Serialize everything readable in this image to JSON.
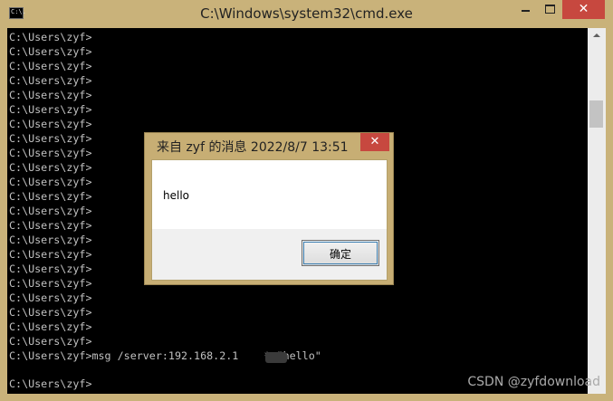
{
  "window": {
    "title": "C:\\Windows\\system32\\cmd.exe",
    "icon_label": "C:\\.",
    "close_glyph": "✕"
  },
  "console": {
    "prompt_lines": [
      "C:\\Users\\zyf>",
      "C:\\Users\\zyf>",
      "C:\\Users\\zyf>",
      "C:\\Users\\zyf>",
      "C:\\Users\\zyf>",
      "C:\\Users\\zyf>",
      "C:\\Users\\zyf>",
      "C:\\Users\\zyf>",
      "C:\\Users\\zyf>",
      "C:\\Users\\zyf>",
      "C:\\Users\\zyf>",
      "C:\\Users\\zyf>",
      "C:\\Users\\zyf>",
      "C:\\Users\\zyf>",
      "C:\\Users\\zyf>",
      "C:\\Users\\zyf>",
      "C:\\Users\\zyf>",
      "C:\\Users\\zyf>",
      "C:\\Users\\zyf>",
      "C:\\Users\\zyf>",
      "C:\\Users\\zyf>",
      "C:\\Users\\zyf>"
    ],
    "command_line": "C:\\Users\\zyf>msg /server:192.168.2.1    * \"hello\"",
    "blank_line": "",
    "last_prompt": "C:\\Users\\zyf>"
  },
  "dialog": {
    "title": "来自 zyf 的消息 2022/8/7 13:51",
    "close_glyph": "✕",
    "message": "hello",
    "ok_label": "确定"
  },
  "watermark": "CSDN @zyfdownload"
}
